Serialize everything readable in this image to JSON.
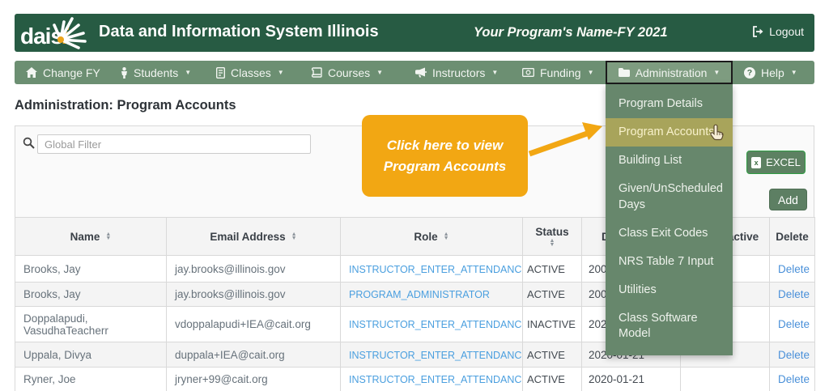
{
  "colors": {
    "header_green": "#275b43",
    "nav_green": "#6c8f72",
    "nav_active_green": "#7e9c80",
    "menu_green": "#67876c",
    "menu_highlight_olive": "#a8a45b",
    "callout_orange": "#f2a713",
    "link_blue": "#4a9fdf",
    "excel_border_green": "#2f9e43"
  },
  "header": {
    "logo_text": "dais",
    "logo_i": "i",
    "title": "Data and Information System Illinois",
    "program_name": "Your Program's Name-FY 2021",
    "logout_label": "Logout"
  },
  "nav": {
    "items": [
      {
        "label": "Change FY",
        "icon": "home-icon"
      },
      {
        "label": "Students",
        "icon": "student-icon"
      },
      {
        "label": "Classes",
        "icon": "classes-icon"
      },
      {
        "label": "Courses",
        "icon": "book-icon"
      },
      {
        "label": "Instructors",
        "icon": "bullhorn-icon"
      },
      {
        "label": "Funding",
        "icon": "money-icon"
      },
      {
        "label": "Administration",
        "icon": "folder-icon",
        "state": "open"
      },
      {
        "label": "Help",
        "icon": "question-icon"
      }
    ]
  },
  "dropdown": {
    "items": [
      "Program Details",
      "Program Accounts",
      "Building List",
      "Given/UnScheduled Days",
      "Class Exit Codes",
      "NRS Table 7 Input",
      "Utilities",
      "Class Software Model"
    ],
    "highlighted_item": "Program Accounts"
  },
  "page": {
    "title": "Administration: Program Accounts"
  },
  "toolbar": {
    "filter_placeholder": "Global Filter",
    "excel_label": "EXCEL",
    "excel_icon_letter": "x",
    "add_label": "Add"
  },
  "callout": {
    "line1": "Click here to view",
    "line2": "Program Accounts"
  },
  "table": {
    "headers": {
      "name": "Name",
      "email": "Email Address",
      "role": "Role",
      "status": "Status",
      "date_active": "Date Active",
      "date_inactive": "Date Inactive",
      "delete": "Delete"
    },
    "rows": [
      {
        "name": "Brooks, Jay",
        "email": "jay.brooks@illinois.gov",
        "role": "INSTRUCTOR_ENTER_ATTENDANCE",
        "status": "ACTIVE",
        "date_active": "200",
        "date_inactive": "",
        "delete": "Delete"
      },
      {
        "name": "Brooks, Jay",
        "email": "jay.brooks@illinois.gov",
        "role": "PROGRAM_ADMINISTRATOR",
        "status": "ACTIVE",
        "date_active": "200",
        "date_inactive": "",
        "delete": "Delete"
      },
      {
        "name": "Doppalapudi, VasudhaTeacherr",
        "email": "vdoppalapudi+IEA@cait.org",
        "role": "INSTRUCTOR_ENTER_ATTENDANCE",
        "status": "INACTIVE",
        "date_active": "202",
        "date_inactive": "",
        "delete": "Delete"
      },
      {
        "name": "Uppala, Divya",
        "email": "duppala+IEA@cait.org",
        "role": "INSTRUCTOR_ENTER_ATTENDANCE",
        "status": "ACTIVE",
        "date_active": "2020-01-21",
        "date_inactive": "",
        "delete": "Delete"
      },
      {
        "name": "Ryner, Joe",
        "email": "jryner+99@cait.org",
        "role": "INSTRUCTOR_ENTER_ATTENDANCE",
        "status": "ACTIVE",
        "date_active": "2020-01-21",
        "date_inactive": "",
        "delete": "Delete"
      }
    ]
  }
}
